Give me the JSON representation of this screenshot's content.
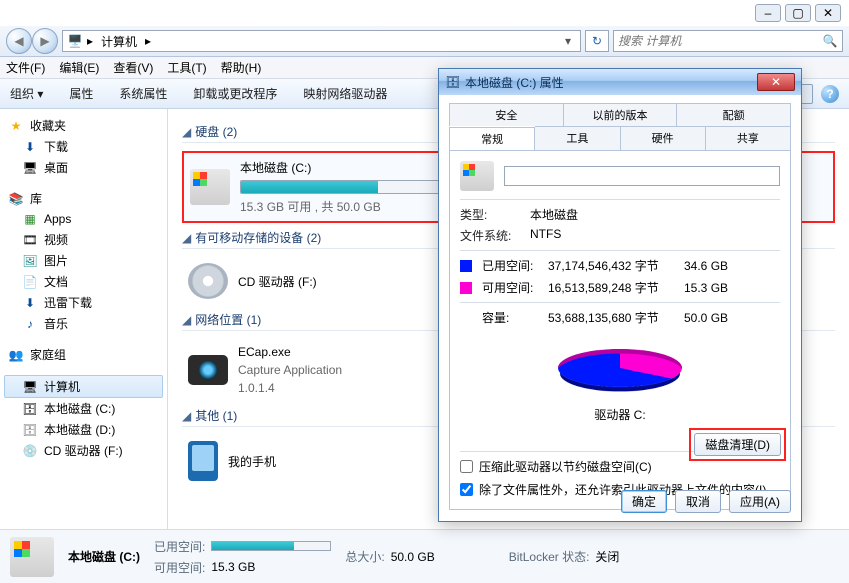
{
  "window": {
    "addr_label": "计算机",
    "search_placeholder": "搜索 计算机"
  },
  "menu": {
    "file": "文件(F)",
    "edit": "编辑(E)",
    "view": "查看(V)",
    "tools": "工具(T)",
    "help": "帮助(H)"
  },
  "toolbar": {
    "organize": "组织",
    "properties": "属性",
    "sysprop": "系统属性",
    "uninstall": "卸载或更改程序",
    "map": "映射网络驱动器"
  },
  "sidebar": {
    "fav": "收藏夹",
    "downloads": "下载",
    "desktop": "桌面",
    "lib": "库",
    "apps": "Apps",
    "video": "视频",
    "pic": "图片",
    "doc": "文档",
    "xunlei": "迅雷下载",
    "music": "音乐",
    "homegroup": "家庭组",
    "computer": "计算机",
    "drive_c": "本地磁盘 (C:)",
    "drive_d": "本地磁盘 (D:)",
    "cd": "CD 驱动器 (F:)"
  },
  "content": {
    "cat_hdd": "硬盘 (2)",
    "c_name": "本地磁盘 (C:)",
    "c_sub": "15.3 GB 可用 , 共 50.0 GB",
    "c_fill_pct": 69,
    "cat_removable": "有可移动存储的设备 (2)",
    "cd_name": "CD 驱动器 (F:)",
    "cat_net": "网络位置 (1)",
    "ecap_name": "ECap.exe",
    "ecap_l1": "Capture Application",
    "ecap_l2": "1.0.1.4",
    "cat_other": "其他 (1)",
    "phone": "我的手机"
  },
  "status": {
    "title": "本地磁盘 (C:)",
    "used_label": "已用空间:",
    "free_label": "可用空间:",
    "free_val": "15.3 GB",
    "total_label": "总大小:",
    "total_val": "50.0 GB",
    "bitlocker_label": "BitLocker 状态:",
    "bitlocker_val": "关闭",
    "fill_pct": 69
  },
  "dialog": {
    "title": "本地磁盘 (C:) 属性",
    "tabs_row1": {
      "security": "安全",
      "prev": "以前的版本",
      "quota": "配额"
    },
    "tabs_row2": {
      "general": "常规",
      "tools": "工具",
      "hardware": "硬件",
      "sharing": "共享"
    },
    "name_value": "",
    "type_label": "类型:",
    "type_val": "本地磁盘",
    "fs_label": "文件系统:",
    "fs_val": "NTFS",
    "used_label": "已用空间:",
    "used_bytes": "37,174,546,432 字节",
    "used_gb": "34.6 GB",
    "free_label": "可用空间:",
    "free_bytes": "16,513,589,248 字节",
    "free_gb": "15.3 GB",
    "cap_label": "容量:",
    "cap_bytes": "53,688,135,680 字节",
    "cap_gb": "50.0 GB",
    "drive_label": "驱动器 C:",
    "cleanup_btn": "磁盘清理(D)",
    "compress_chk": "压缩此驱动器以节约磁盘空间(C)",
    "index_chk": "除了文件属性外，还允许索引此驱动器上文件的内容(I)",
    "ok": "确定",
    "cancel": "取消",
    "apply": "应用(A)"
  },
  "chart_data": {
    "type": "pie",
    "title": "驱动器 C:",
    "series": [
      {
        "name": "已用空间",
        "value_bytes": 37174546432,
        "value_gb": 34.6,
        "color": "#0018ff"
      },
      {
        "name": "可用空间",
        "value_bytes": 16513589248,
        "value_gb": 15.3,
        "color": "#ff00d4"
      }
    ],
    "total_bytes": 53688135680,
    "total_gb": 50.0
  }
}
